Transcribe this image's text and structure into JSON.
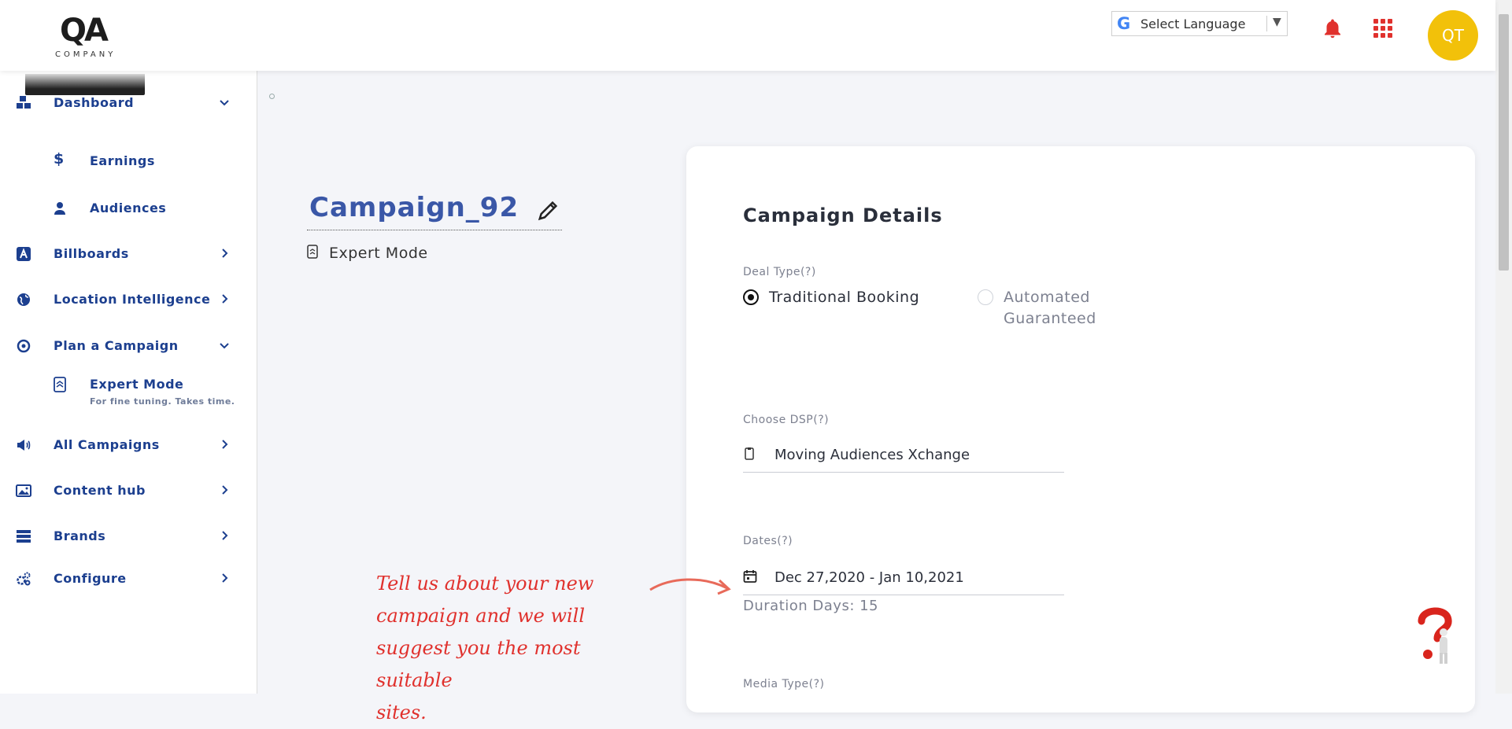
{
  "brand": {
    "logo_text": "QA",
    "logo_sub": "COMPANY"
  },
  "header": {
    "language_label": "Select Language",
    "language_logo": "G",
    "avatar_initials": "QT"
  },
  "sidebar": {
    "items": [
      {
        "label": "Dashboard",
        "icon": "cubes-icon"
      },
      {
        "label": "Earnings",
        "icon": "dollar-icon"
      },
      {
        "label": "Audiences",
        "icon": "user-icon"
      },
      {
        "label": "Billboards",
        "icon": "billboard-icon"
      },
      {
        "label": "Location Intelligence",
        "icon": "globe-icon"
      },
      {
        "label": "Plan a Campaign",
        "icon": "target-icon"
      },
      {
        "label": "Expert Mode",
        "icon": "expert-mode-icon",
        "desc": "For fine tuning. Takes time."
      },
      {
        "label": "All Campaigns",
        "icon": "megaphone-icon"
      },
      {
        "label": "Content hub",
        "icon": "image-icon"
      },
      {
        "label": "Brands",
        "icon": "brands-icon"
      },
      {
        "label": "Configure",
        "icon": "gears-icon"
      }
    ]
  },
  "campaign": {
    "title": "Campaign_92",
    "mode": "Expert Mode"
  },
  "card": {
    "title": "Campaign Details",
    "deal_type_label": "Deal Type(?)",
    "deal_options": [
      "Traditional Booking",
      "Automated",
      "Guaranteed"
    ],
    "dsp_label": "Choose DSP(?)",
    "dsp_value": "Moving Audiences Xchange",
    "dates_label": "Dates(?)",
    "dates_value": "Dec 27,2020 - Jan 10,2021",
    "duration": "Duration Days: 15",
    "media_type_label": "Media Type(?)"
  },
  "note": {
    "lines": [
      "Tell us about your new",
      "campaign and we will",
      "suggest you the most suitable",
      "sites."
    ]
  },
  "colors": {
    "accent": "#1c3f8f",
    "title": "#3a57a7",
    "red": "#e0312d",
    "avatar": "#f2c10a"
  }
}
